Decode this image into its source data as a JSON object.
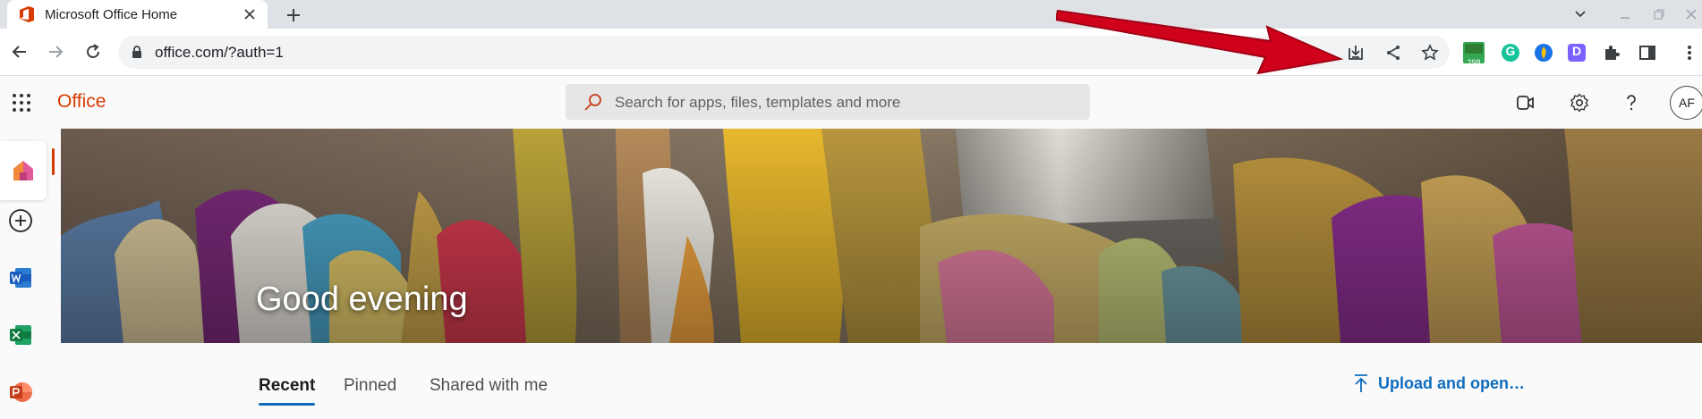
{
  "browser": {
    "tab": {
      "title": "Microsoft Office Home",
      "close_label": "×"
    },
    "new_tab_label": "+",
    "address": {
      "url": "office.com/?auth=1"
    },
    "extensions": {
      "badge_count": "298",
      "grammarly_letter": "G",
      "d_letter": "D"
    }
  },
  "office": {
    "brand": "Office",
    "search": {
      "placeholder": "Search for apps, files, templates and more"
    },
    "user_initials": "AF",
    "hero": {
      "greeting": "Good evening"
    },
    "tabs": [
      {
        "label": "Recent",
        "active": true
      },
      {
        "label": "Pinned",
        "active": false
      },
      {
        "label": "Shared with me",
        "active": false
      }
    ],
    "upload_label": "Upload and open…"
  },
  "colors": {
    "office_orange": "#d83b01",
    "link_blue": "#0f6cbd",
    "annotation_red": "#d0021b"
  }
}
